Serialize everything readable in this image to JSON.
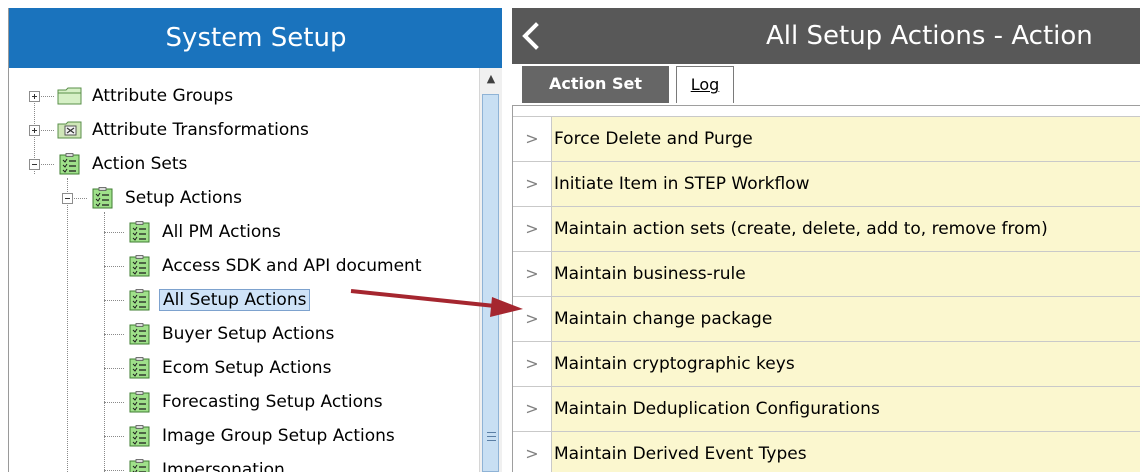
{
  "left_panel": {
    "title": "System Setup",
    "tree": [
      {
        "label": "Attribute Groups",
        "icon": "folder-icon",
        "level": 0,
        "expander": "plus"
      },
      {
        "label": "Attribute Transformations",
        "icon": "attribute-transformation-icon",
        "level": 0,
        "expander": "plus"
      },
      {
        "label": "Action Sets",
        "icon": "action-set-icon",
        "level": 0,
        "expander": "minus"
      },
      {
        "label": "Setup Actions",
        "icon": "action-set-icon",
        "level": 1,
        "expander": "minus"
      },
      {
        "label": "All PM Actions",
        "icon": "action-set-icon",
        "level": 2
      },
      {
        "label": "Access SDK and API document",
        "icon": "action-set-icon",
        "level": 2
      },
      {
        "label": "All Setup Actions",
        "icon": "action-set-icon",
        "level": 2,
        "selected": true
      },
      {
        "label": "Buyer Setup Actions",
        "icon": "action-set-icon",
        "level": 2
      },
      {
        "label": "Ecom Setup Actions",
        "icon": "action-set-icon",
        "level": 2
      },
      {
        "label": "Forecasting Setup Actions",
        "icon": "action-set-icon",
        "level": 2
      },
      {
        "label": "Image Group Setup Actions",
        "icon": "action-set-icon",
        "level": 2
      },
      {
        "label": "Impersonation",
        "icon": "action-set-icon",
        "level": 2
      }
    ]
  },
  "right_panel": {
    "title": "All Setup Actions - Action",
    "back_icon": "chevron-left-icon",
    "tabs": [
      {
        "label": "Action Set",
        "active": true
      },
      {
        "label": "Log",
        "active": false
      }
    ],
    "rows": [
      "Force Delete and Purge",
      "Initiate Item in STEP Workflow",
      "Maintain action sets (create, delete, add to, remove from)",
      "Maintain business-rule",
      "Maintain change package",
      "Maintain cryptographic keys",
      "Maintain Deduplication Configurations",
      "Maintain Derived Event Types"
    ],
    "row_chevron": ">"
  },
  "colors": {
    "left_header_bg": "#1a73bd",
    "right_header_bg": "#585858",
    "row_bg": "#fbf7cf",
    "arrow": "#a5262f",
    "selected_bg": "#cfe3f8"
  }
}
